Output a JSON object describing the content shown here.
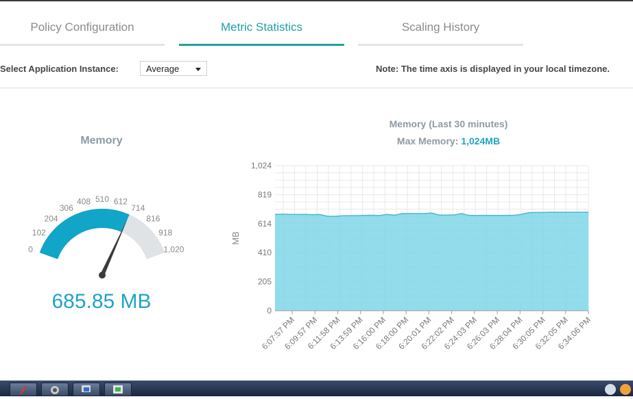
{
  "tabs": [
    {
      "label": "Policy Configuration",
      "active": false
    },
    {
      "label": "Metric Statistics",
      "active": true
    },
    {
      "label": "Scaling History",
      "active": false
    }
  ],
  "toolbar": {
    "instance_label": "Select Application Instance:",
    "instance_value": "Average",
    "note": "Note: The time axis is displayed in your local timezone."
  },
  "gauge": {
    "title": "Memory",
    "value_text": "685.85 MB",
    "value": 685.85,
    "min": 0,
    "max": 1020,
    "ticks": [
      "0",
      "102",
      "204",
      "306",
      "408",
      "510",
      "612",
      "714",
      "816",
      "918",
      "1,020"
    ],
    "fill_color": "#11a5c8",
    "track_color": "#dfe3e6"
  },
  "chart_data": {
    "type": "area",
    "title": "Memory (Last 30 minutes)",
    "subtitle_label": "Max Memory:",
    "subtitle_value": "1,024MB",
    "ylabel": "MB",
    "ylim": [
      0,
      1024
    ],
    "yticks": [
      "0",
      "205",
      "410",
      "614",
      "819",
      "1,024"
    ],
    "xticks": [
      "6:07:57 PM",
      "6:09:57 PM",
      "6:11:58 PM",
      "6:13:59 PM",
      "6:16:00 PM",
      "6:18:00 PM",
      "6:20:01 PM",
      "6:22:02 PM",
      "6:24:03 PM",
      "6:26:03 PM",
      "6:28:04 PM",
      "6:30:05 PM",
      "6:32:05 PM",
      "6:34:06 PM"
    ],
    "grid": true,
    "fill_color": "#7fd6e8",
    "line_color": "#4ab8cf",
    "series": [
      {
        "values": [
          680,
          681,
          680,
          679,
          680,
          678,
          679,
          667,
          666,
          670,
          671,
          671,
          673,
          674,
          672,
          680,
          674,
          685,
          686,
          685,
          685,
          690,
          675,
          675,
          676,
          686,
          673,
          672,
          673,
          673,
          672,
          673,
          673,
          680,
          692,
          694,
          694,
          695,
          695,
          695,
          695,
          695,
          695
        ]
      }
    ]
  },
  "taskbar": {
    "buttons": [
      "app-1",
      "app-2",
      "app-3",
      "app-4"
    ]
  }
}
